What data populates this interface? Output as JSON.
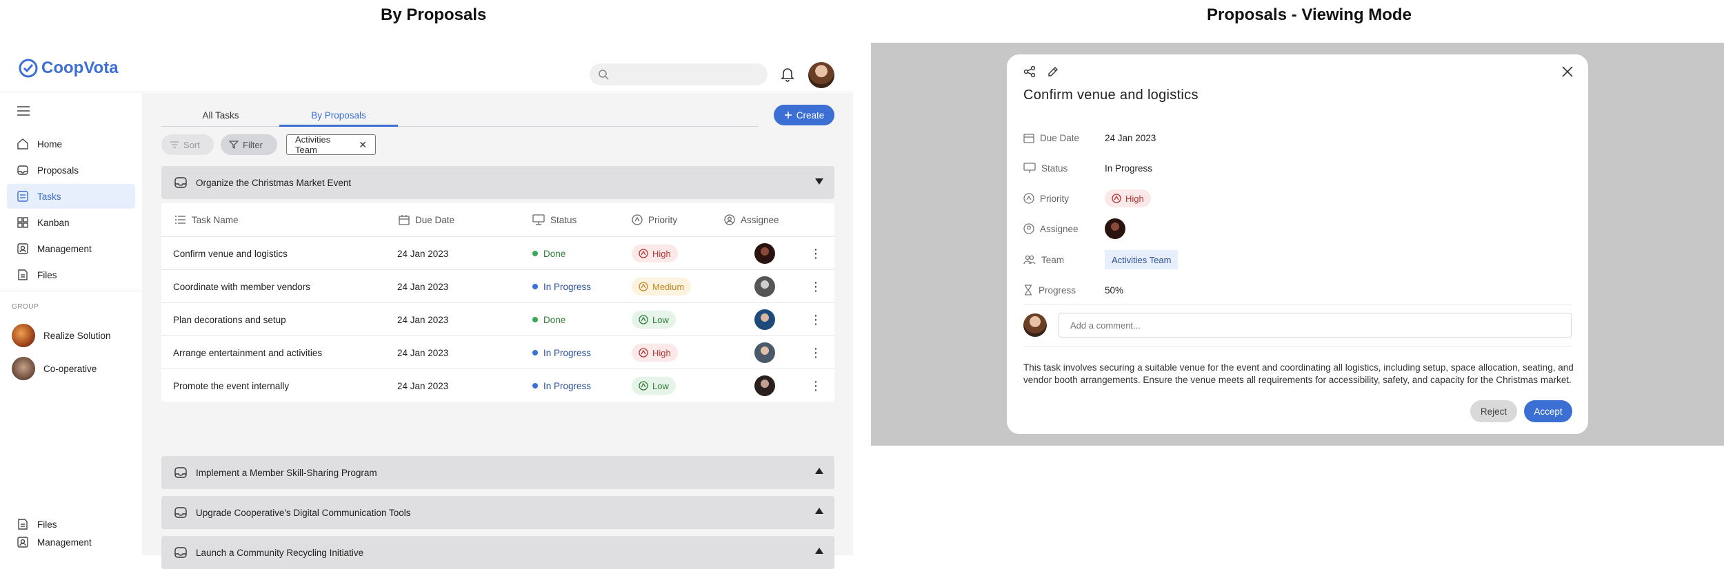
{
  "captions": {
    "left": "By Proposals",
    "right": "Proposals - Viewing Mode"
  },
  "app": {
    "name": "CoopVota",
    "brand_color": "#3b6fd4"
  },
  "header": {
    "search_placeholder": "",
    "bell_icon": "bell-icon"
  },
  "sidebar": {
    "items": [
      {
        "label": "Home",
        "icon": "home-icon"
      },
      {
        "label": "Proposals",
        "icon": "proposals-icon"
      },
      {
        "label": "Tasks",
        "icon": "tasks-icon",
        "active": true
      },
      {
        "label": "Kanban",
        "icon": "kanban-icon"
      },
      {
        "label": "Management",
        "icon": "management-icon"
      },
      {
        "label": "Files",
        "icon": "files-icon"
      }
    ],
    "group_label": "GROUP",
    "groups": [
      {
        "label": "Realize Solution"
      },
      {
        "label": "Co-operative"
      }
    ],
    "bottom_items": [
      {
        "label": "Management"
      },
      {
        "label": "Files"
      }
    ]
  },
  "main": {
    "tabs": [
      {
        "label": "All Tasks"
      },
      {
        "label": "By Proposals",
        "active": true
      }
    ],
    "create_label": "Create",
    "sort_label": "Sort",
    "filter_label": "Filter",
    "filter_chip": "Activities Team",
    "proposal_groups": [
      {
        "title": "Organize the Christmas Market Event",
        "expanded": true
      },
      {
        "title": "Implement a Member Skill-Sharing Program",
        "expanded": false
      },
      {
        "title": "Upgrade Cooperative's Digital Communication Tools",
        "expanded": false
      },
      {
        "title": "Launch a Community Recycling Initiative",
        "expanded": false
      }
    ],
    "columns": {
      "task": "Task Name",
      "due": "Due Date",
      "status": "Status",
      "priority": "Priority",
      "assignee": "Assignee"
    },
    "rows": [
      {
        "task": "Confirm venue and logistics",
        "due": "24 Jan 2023",
        "status": "Done",
        "priority": "High"
      },
      {
        "task": "Coordinate with member vendors",
        "due": "24 Jan 2023",
        "status": "In Progress",
        "priority": "Medium"
      },
      {
        "task": "Plan decorations and setup",
        "due": "24 Jan 2023",
        "status": "Done",
        "priority": "Low"
      },
      {
        "task": "Arrange entertainment and activities",
        "due": "24 Jan 2023",
        "status": "In Progress",
        "priority": "High"
      },
      {
        "task": "Promote the event internally",
        "due": "24 Jan 2023",
        "status": "In Progress",
        "priority": "Low"
      }
    ],
    "status_colors": {
      "Done": "#3aa757",
      "In Progress": "#3b6fd4"
    }
  },
  "modal": {
    "title": "Confirm venue and logistics",
    "fields": {
      "due_label": "Due Date",
      "due_value": "24 Jan 2023",
      "status_label": "Status",
      "status_value": "In Progress",
      "priority_label": "Priority",
      "priority_value": "High",
      "assignee_label": "Assignee",
      "team_label": "Team",
      "team_value": "Activities Team",
      "progress_label": "Progress",
      "progress_value": "50%"
    },
    "comment_placeholder": "Add a comment...",
    "description": "This task involves securing a suitable venue for the event and coordinating all logistics, including setup, space allocation, seating, and vendor booth arrangements. Ensure the venue meets all requirements for accessibility, safety, and capacity for the Christmas market.",
    "reject_label": "Reject",
    "accept_label": "Accept"
  }
}
